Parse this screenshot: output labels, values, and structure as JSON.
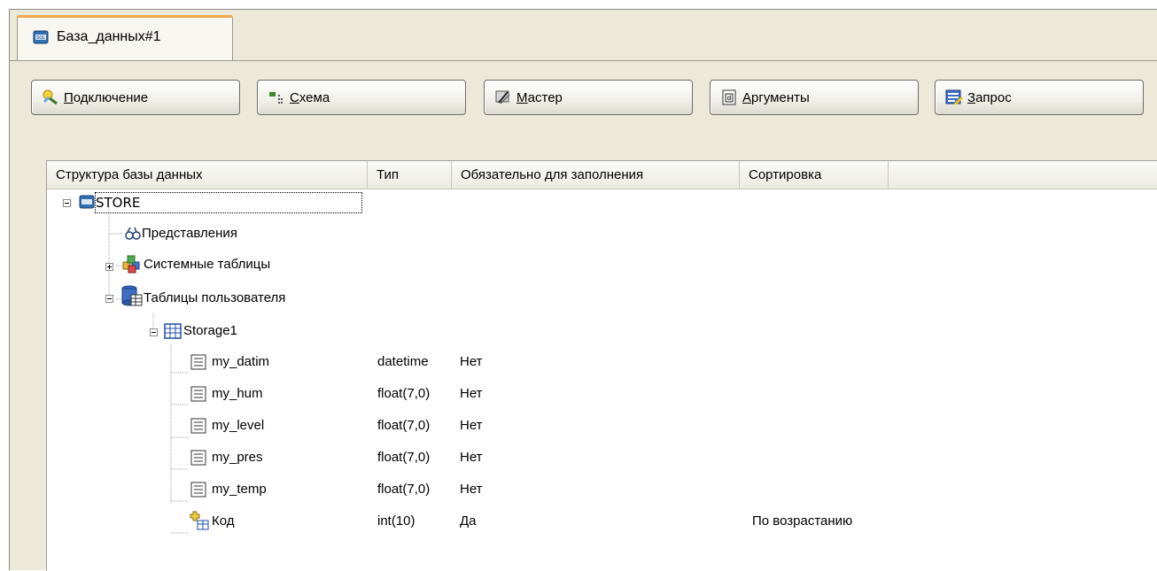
{
  "tab": {
    "label": "База_данных#1",
    "icon": "database-sql-icon"
  },
  "toolbar": {
    "buttons": [
      {
        "label_pre": "",
        "label_ul": "П",
        "label_post": "одключение",
        "icon": "connect-icon"
      },
      {
        "label_pre": "",
        "label_ul": "С",
        "label_post": "хема",
        "icon": "schema-icon"
      },
      {
        "label_pre": "",
        "label_ul": "М",
        "label_post": "астер",
        "icon": "wizard-icon"
      },
      {
        "label_pre": "",
        "label_ul": "А",
        "label_post": "ргументы",
        "icon": "arguments-icon"
      },
      {
        "label_pre": "",
        "label_ul": "З",
        "label_post": "апрос",
        "icon": "query-icon"
      }
    ]
  },
  "grid": {
    "columns": [
      "Структура базы данных",
      "Тип",
      "Обязательно для заполнения",
      "Сортировка"
    ],
    "tree": {
      "root": "STORE",
      "views": "Представления",
      "system_tables": "Системные таблицы",
      "user_tables": "Таблицы пользователя",
      "table": "Storage1",
      "fields": [
        {
          "name": "my_datim",
          "type": "datetime",
          "required": "Нет",
          "sort": ""
        },
        {
          "name": "my_hum",
          "type": "float(7,0)",
          "required": "Нет",
          "sort": ""
        },
        {
          "name": "my_level",
          "type": "float(7,0)",
          "required": "Нет",
          "sort": ""
        },
        {
          "name": "my_pres",
          "type": "float(7,0)",
          "required": "Нет",
          "sort": ""
        },
        {
          "name": "my_temp",
          "type": "float(7,0)",
          "required": "Нет",
          "sort": ""
        },
        {
          "name": "Код",
          "type": "int(10)",
          "required": "Да",
          "sort": "По возрастанию"
        }
      ]
    }
  }
}
